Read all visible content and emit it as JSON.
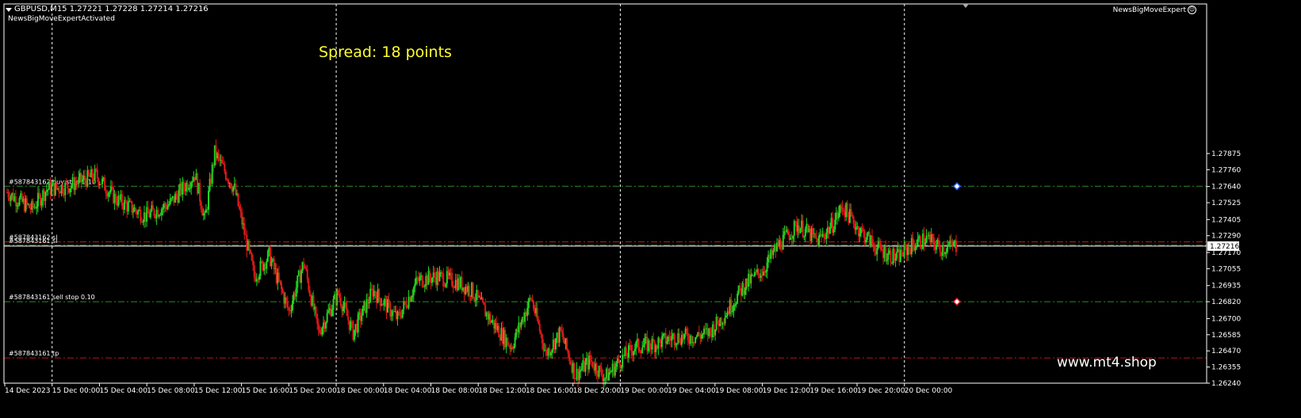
{
  "header": {
    "symbol_line": "GBPUSD,M15  1.27221 1.27228 1.27214 1.27216",
    "ea_status": "NewsBigMoveExpertActivated",
    "expert_name": "NewsBigMoveExpert",
    "expert_icon": "smiley-icon"
  },
  "overlay": {
    "spread_text": "Spread: 18 points",
    "watermark": "www.mt4.shop"
  },
  "colors": {
    "background": "#000000",
    "bull": "#22d622",
    "bear": "#e01919",
    "level_green": "#2e8b2e",
    "level_red": "#c0141a",
    "grid": "#ffffff",
    "spread_text": "#ffff33"
  },
  "chart_data": {
    "type": "candlestick",
    "title": "GBPUSD,M15",
    "ylim": [
      1.2624,
      1.2894
    ],
    "current_price": 1.27216,
    "current_price_label": "1.27216",
    "y_ticks": [
      {
        "value": 1.27875,
        "label": "1.27875"
      },
      {
        "value": 1.2776,
        "label": "1.27760"
      },
      {
        "value": 1.2764,
        "label": "1.27640"
      },
      {
        "value": 1.27525,
        "label": "1.27525"
      },
      {
        "value": 1.27405,
        "label": "1.27405"
      },
      {
        "value": 1.2729,
        "label": "1.27290"
      },
      {
        "value": 1.2717,
        "label": "1.27170"
      },
      {
        "value": 1.27055,
        "label": "1.27055"
      },
      {
        "value": 1.26935,
        "label": "1.26935"
      },
      {
        "value": 1.2682,
        "label": "1.26820"
      },
      {
        "value": 1.267,
        "label": "1.26700"
      },
      {
        "value": 1.26585,
        "label": "1.26585"
      },
      {
        "value": 1.2647,
        "label": "1.26470"
      },
      {
        "value": 1.26355,
        "label": "1.26355"
      },
      {
        "value": 1.2624,
        "label": "1.26240"
      }
    ],
    "x_ticks": [
      "14 Dec 2023",
      "15 Dec 00:00",
      "15 Dec 04:00",
      "15 Dec 08:00",
      "15 Dec 12:00",
      "15 Dec 16:00",
      "15 Dec 20:00",
      "18 Dec 00:00",
      "18 Dec 04:00",
      "18 Dec 08:00",
      "18 Dec 12:00",
      "18 Dec 16:00",
      "18 Dec 20:00",
      "19 Dec 00:00",
      "19 Dec 04:00",
      "19 Dec 08:00",
      "19 Dec 12:00",
      "19 Dec 16:00",
      "19 Dec 20:00",
      "20 Dec 00:00"
    ],
    "day_separators": [
      "15 Dec 00:00",
      "18 Dec 00:00",
      "19 Dec 00:00",
      "20 Dec 00:00"
    ],
    "levels": [
      {
        "label": "#587843162 buy stop 0.10",
        "price": 1.27642,
        "style": "dash-dot",
        "color": "#2e8b2e",
        "marker": "blue"
      },
      {
        "label": "#587843162 sl",
        "price": 1.27246,
        "style": "dash-dot",
        "color": "#c0141a"
      },
      {
        "label": "#587843161 sl",
        "price": 1.27222,
        "style": "dash-dot",
        "color": "#2e8b2e"
      },
      {
        "label": "#587843161 sell stop 0.10",
        "price": 1.2682,
        "style": "dash-dot",
        "color": "#2e8b2e",
        "marker": "red"
      },
      {
        "label": "#587843161 tp",
        "price": 1.2642,
        "style": "dash-dot",
        "color": "#c0141a"
      }
    ],
    "price_path": [
      [
        0,
        1.276
      ],
      [
        2,
        1.2755
      ],
      [
        5,
        1.2748
      ],
      [
        8,
        1.2762
      ],
      [
        12,
        1.2764
      ],
      [
        18,
        1.2772
      ],
      [
        22,
        1.2755
      ],
      [
        28,
        1.2743
      ],
      [
        33,
        1.2752
      ],
      [
        38,
        1.2773
      ],
      [
        40,
        1.274
      ],
      [
        42,
        1.2788
      ],
      [
        46,
        1.2762
      ],
      [
        50,
        1.27
      ],
      [
        53,
        1.2715
      ],
      [
        57,
        1.2675
      ],
      [
        60,
        1.271
      ],
      [
        63,
        1.266
      ],
      [
        67,
        1.2688
      ],
      [
        70,
        1.266
      ],
      [
        74,
        1.269
      ],
      [
        79,
        1.267
      ],
      [
        83,
        1.2697
      ],
      [
        87,
        1.27
      ],
      [
        91,
        1.2696
      ],
      [
        94,
        1.269
      ],
      [
        98,
        1.2668
      ],
      [
        102,
        1.265
      ],
      [
        106,
        1.2685
      ],
      [
        109,
        1.2645
      ],
      [
        112,
        1.266
      ],
      [
        115,
        1.263
      ],
      [
        118,
        1.264
      ],
      [
        121,
        1.2628
      ],
      [
        124,
        1.264
      ],
      [
        127,
        1.265
      ],
      [
        131,
        1.2652
      ],
      [
        135,
        1.2657
      ],
      [
        139,
        1.2657
      ],
      [
        142,
        1.266
      ],
      [
        145,
        1.2672
      ],
      [
        149,
        1.2693
      ],
      [
        153,
        1.2705
      ],
      [
        156,
        1.2722
      ],
      [
        160,
        1.2737
      ],
      [
        164,
        1.2725
      ],
      [
        167,
        1.2737
      ],
      [
        169,
        1.275
      ],
      [
        172,
        1.2735
      ],
      [
        176,
        1.272
      ],
      [
        180,
        1.2713
      ],
      [
        183,
        1.2722
      ],
      [
        186,
        1.2727
      ],
      [
        189,
        1.272
      ],
      [
        192,
        1.2722
      ]
    ],
    "price_path_bar_count": 192
  }
}
